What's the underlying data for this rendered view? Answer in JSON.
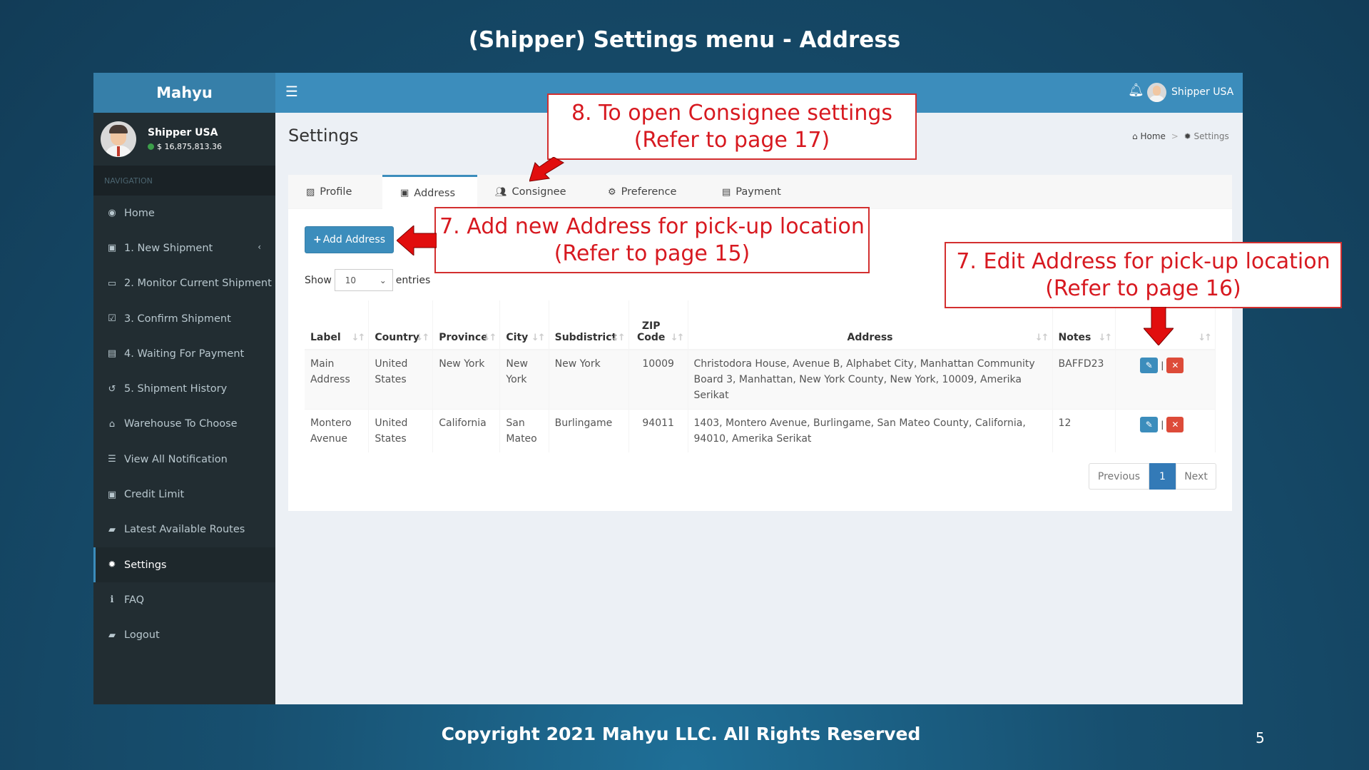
{
  "slide": {
    "title": "(Shipper) Settings menu - Address",
    "footer": "Copyright 2021 Mahyu LLC. All Rights Reserved",
    "page_number": "5"
  },
  "app": {
    "brand": "Mahyu",
    "user": {
      "name": "Shipper USA",
      "balance": "$ 16,875,813.36"
    },
    "top_user": "Shipper USA"
  },
  "sidebar": {
    "header": "NAVIGATION",
    "items": [
      {
        "label": "Home",
        "icon": "dashboard-icon"
      },
      {
        "label": "1. New Shipment",
        "icon": "shipment-icon"
      },
      {
        "label": "2. Monitor Current Shipment",
        "icon": "laptop-icon"
      },
      {
        "label": "3. Confirm Shipment",
        "icon": "check-square-icon"
      },
      {
        "label": "4. Waiting For Payment",
        "icon": "credit-card-icon"
      },
      {
        "label": "5. Shipment History",
        "icon": "history-icon"
      },
      {
        "label": "Warehouse To Choose",
        "icon": "warehouse-icon"
      },
      {
        "label": "View All Notification",
        "icon": "list-icon"
      },
      {
        "label": "Credit Limit",
        "icon": "money-icon"
      },
      {
        "label": "Latest Available Routes",
        "icon": "book-icon"
      },
      {
        "label": "Settings",
        "icon": "gear-icon"
      },
      {
        "label": "FAQ",
        "icon": "info-icon"
      },
      {
        "label": "Logout",
        "icon": "book-icon"
      }
    ]
  },
  "page": {
    "title": "Settings",
    "breadcrumb": {
      "home": "Home",
      "current": "Settings"
    }
  },
  "tabs": [
    {
      "label": "Profile"
    },
    {
      "label": "Address"
    },
    {
      "label": "Consignee"
    },
    {
      "label": "Preference"
    },
    {
      "label": "Payment"
    }
  ],
  "address": {
    "add_button": "Add Address",
    "show_label": "Show",
    "entries_value": "10",
    "entries_label": "entries",
    "columns": [
      "Label",
      "Country",
      "Province",
      "City",
      "Subdistrict",
      "ZIP Code",
      "Address",
      "Notes",
      ""
    ],
    "rows": [
      {
        "label": "Main Address",
        "country": "United States",
        "province": "New York",
        "city": "New York",
        "subdistrict": "New York",
        "zip": "10009",
        "address": "Christodora House, Avenue B, Alphabet City, Manhattan Community Board 3, Manhattan, New York County, New York, 10009, Amerika Serikat",
        "notes": "BAFFD23"
      },
      {
        "label": "Montero Avenue",
        "country": "United States",
        "province": "California",
        "city": "San Mateo",
        "subdistrict": "Burlingame",
        "zip": "94011",
        "address": "1403, Montero Avenue, Burlingame, San Mateo County, California, 94010, Amerika Serikat",
        "notes": "12"
      }
    ],
    "pager": {
      "previous": "Previous",
      "current": "1",
      "next": "Next"
    }
  },
  "annotations": {
    "consignee": [
      "8. To open Consignee settings",
      "(Refer to page 17)"
    ],
    "add": [
      "7. Add new Address for pick-up location",
      "(Refer to page 15)"
    ],
    "edit": [
      "7. Edit Address for pick-up location",
      "(Refer to page 16)"
    ]
  },
  "colors": {
    "accent": "#3c8dbc",
    "sidebar": "#222d32",
    "danger": "#dd4b39",
    "annotation": "#d71920"
  }
}
